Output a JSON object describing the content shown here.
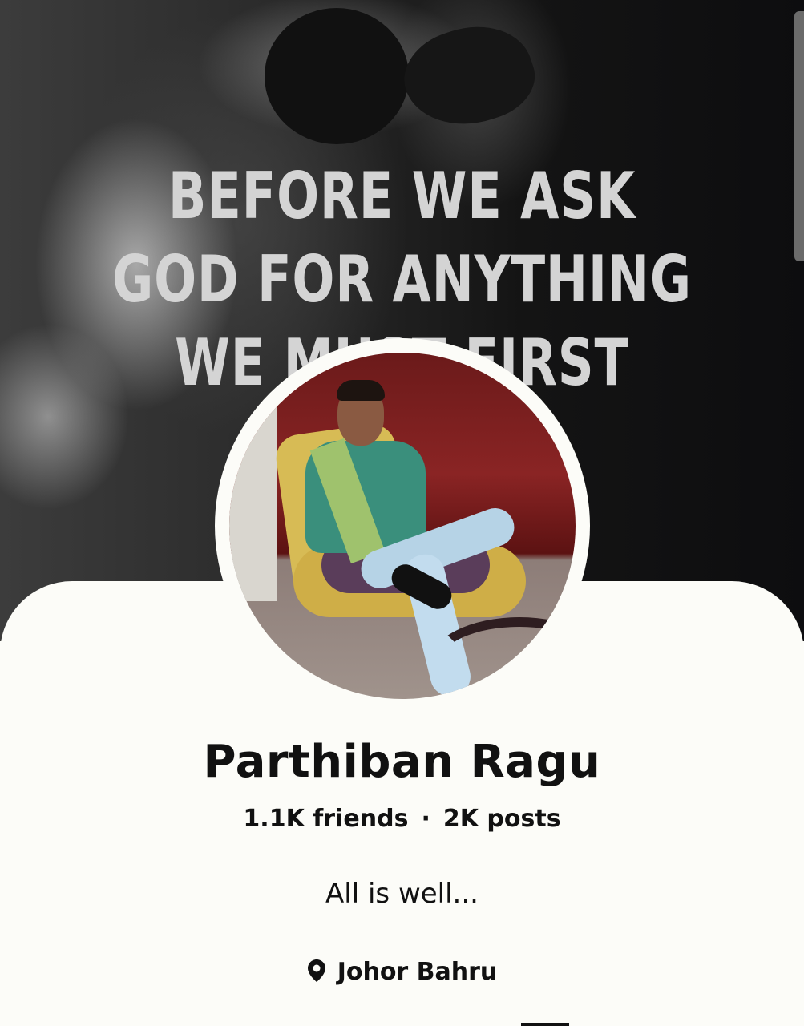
{
  "cover": {
    "quote_lines": [
      "BEFORE WE ASK",
      "GOD FOR ANYTHING",
      "WE MUST FIRST"
    ]
  },
  "profile": {
    "name": "Parthiban Ragu",
    "friends": "1.1K friends",
    "separator": "·",
    "posts": "2K posts",
    "bio": "All is well...",
    "location": "Johor Bahru"
  },
  "icons": {
    "location": "location-pin-icon"
  },
  "colors": {
    "card_background": "#fcfcf8",
    "text": "#111111",
    "cover_text": "#d4d4d4"
  }
}
